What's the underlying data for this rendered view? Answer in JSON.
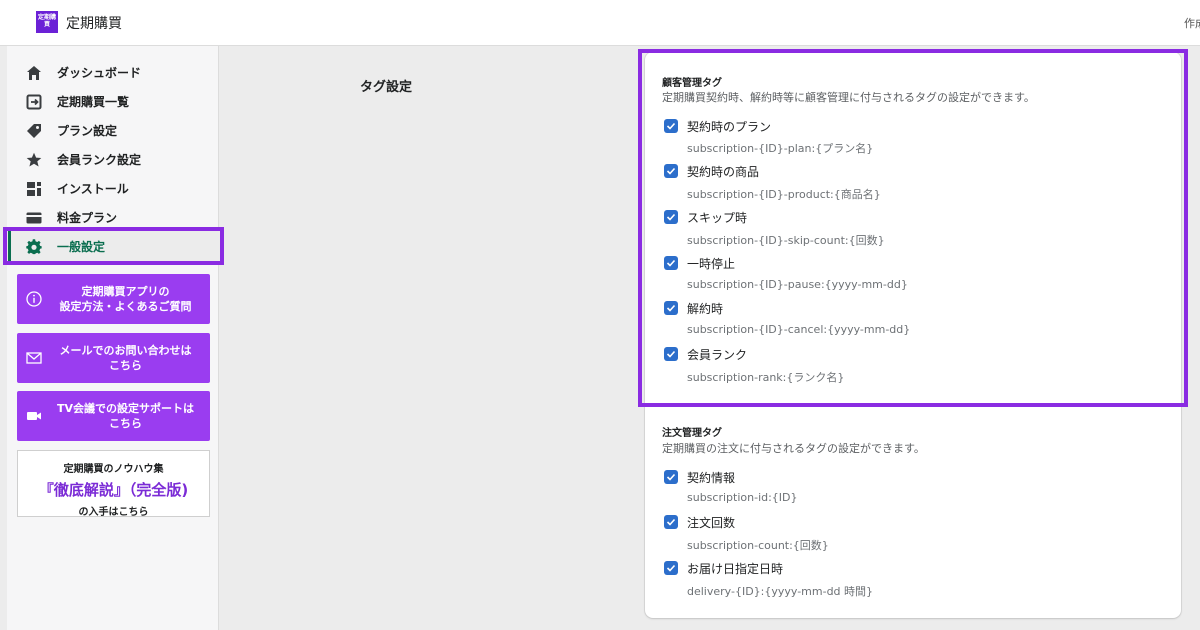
{
  "app": {
    "logo_text": "定期購買",
    "title": "定期購買",
    "top_right_text": "作成"
  },
  "sidebar": {
    "items": [
      {
        "label": "ダッシュボード",
        "icon": "home-icon"
      },
      {
        "label": "定期購買一覧",
        "icon": "subscription-list-icon"
      },
      {
        "label": "プラン設定",
        "icon": "tag-icon"
      },
      {
        "label": "会員ランク設定",
        "icon": "star-icon"
      },
      {
        "label": "インストール",
        "icon": "apps-icon"
      },
      {
        "label": "料金プラン",
        "icon": "card-icon"
      },
      {
        "label": "一般設定",
        "icon": "gear-icon",
        "active": true
      }
    ],
    "help_buttons": [
      {
        "line1": "定期購買アプリの",
        "line2": "設定方法・よくあるご質問",
        "icon": "info-icon"
      },
      {
        "line1": "メールでのお問い合わせは",
        "line2": "こちら",
        "icon": "mail-icon"
      },
      {
        "line1": "TV会議での設定サポートは",
        "line2": "こちら",
        "icon": "video-icon"
      }
    ],
    "promo": {
      "line1": "定期購買のノウハウ集",
      "line2": "『徹底解説』（完全版)",
      "line3": "の入手はこちら"
    }
  },
  "main": {
    "section_title": "タグ設定",
    "customer_tags": {
      "title": "顧客管理タグ",
      "description": "定期購買契約時、解約時等に顧客管理に付与されるタグの設定ができます。",
      "options": [
        {
          "label": "契約時のプラン",
          "help": "subscription-{ID}-plan:{プラン名}",
          "checked": true
        },
        {
          "label": "契約時の商品",
          "help": "subscription-{ID}-product:{商品名}",
          "checked": true
        },
        {
          "label": "スキップ時",
          "help": "subscription-{ID}-skip-count:{回数}",
          "checked": true
        },
        {
          "label": "一時停止",
          "help": "subscription-{ID}-pause:{yyyy-mm-dd}",
          "checked": true
        },
        {
          "label": "解約時",
          "help": "subscription-{ID}-cancel:{yyyy-mm-dd}",
          "checked": true
        },
        {
          "label": "会員ランク",
          "help": "subscription-rank:{ランク名}",
          "checked": true
        }
      ]
    },
    "order_tags": {
      "title": "注文管理タグ",
      "description": "定期購買の注文に付与されるタグの設定ができます。",
      "options": [
        {
          "label": "契約情報",
          "help": "subscription-id:{ID}",
          "checked": true
        },
        {
          "label": "注文回数",
          "help": "subscription-count:{回数}",
          "checked": true
        },
        {
          "label": "お届け日指定日時",
          "help": "delivery-{ID}:{yyyy-mm-dd 時間}",
          "checked": true
        }
      ]
    }
  },
  "colors": {
    "accent_purple": "#8a2be2",
    "help_button": "#9a3df0",
    "checkbox_blue": "#2c6ecb",
    "active_green": "#0a6e4f"
  }
}
